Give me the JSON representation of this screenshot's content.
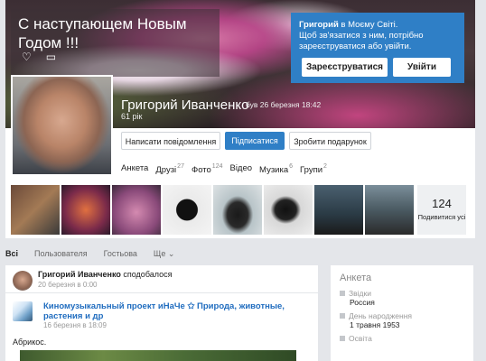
{
  "cover": {
    "status_text": "С наступающем Новым Годом !!!",
    "like_icon": "heart-icon",
    "comment_icon": "comment-icon"
  },
  "login_prompt": {
    "name": "Григорий",
    "line1_suffix": " в Моєму Світі.",
    "line2": "Щоб зв'язатися з ним, потрібно зареєструватися або увійти.",
    "register_label": "Зареєструватися",
    "login_label": "Увійти"
  },
  "profile": {
    "name": "Григорий Иванченко",
    "last_seen": "був 26 березня 18:42",
    "age": "61 рік",
    "write_message": "Написати повідомлення",
    "subscribe": "Підписатися",
    "gift": "Зробити подарунок"
  },
  "tabs": [
    {
      "label": "Анкета",
      "count": ""
    },
    {
      "label": "Друзі",
      "count": "27"
    },
    {
      "label": "Фото",
      "count": "124"
    },
    {
      "label": "Відео",
      "count": ""
    },
    {
      "label": "Музика",
      "count": "6"
    },
    {
      "label": "Групи",
      "count": "2"
    }
  ],
  "photos": {
    "count": "124",
    "count_label": "Подивитися усі"
  },
  "feed_tabs": [
    "Всі",
    "Пользователя",
    "Гостьова",
    "Ще"
  ],
  "feed": {
    "item1_author": "Григорий Иванченко",
    "item1_action": "сподобалося",
    "item1_date": "20 березня в 0:00",
    "item2_title": "Киномузыкальный проект иНаЧе ✩ Природа, животные, растения и др",
    "item2_date": "16 березня в 18:09",
    "item2_text": "Абрикос."
  },
  "about": {
    "title": "Анкета",
    "origin_label": "Звідки",
    "origin_value": "Россия",
    "birthday_label": "День народження",
    "birthday_value": "1 травня 1953",
    "education_label": "Освіта"
  }
}
